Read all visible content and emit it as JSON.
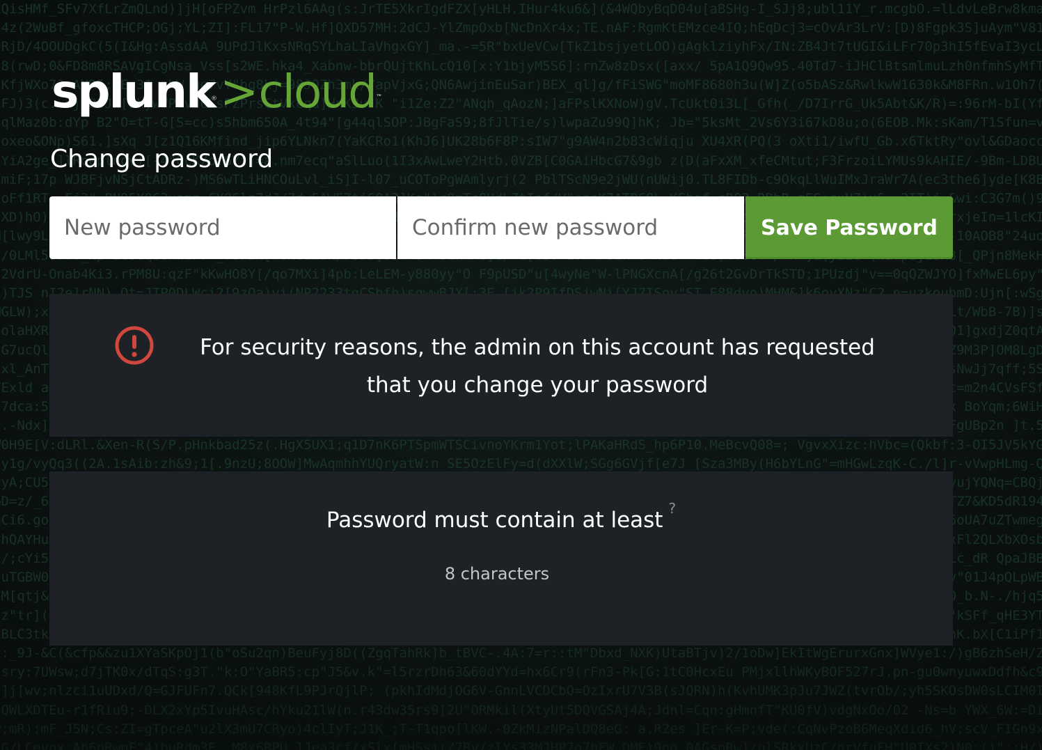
{
  "logo": {
    "brand": "splunk",
    "separator": ">",
    "product": "cloud",
    "registered_mark": "®",
    "trademark_mark": "™"
  },
  "page": {
    "title": "Change password"
  },
  "form": {
    "new_password_placeholder": "New password",
    "new_password_value": "",
    "confirm_password_placeholder": "Confirm new password",
    "confirm_password_value": "",
    "save_label": "Save Password"
  },
  "alert": {
    "icon": "exclamation-circle-icon",
    "message": "For security reasons, the admin on this account has requested that you change your password"
  },
  "requirements": {
    "title": "Password must contain at least",
    "help_mark": "?",
    "items": [
      "8 characters"
    ]
  },
  "colors": {
    "accent_green": "#65a637",
    "button_green": "#5b9a35",
    "panel_bg": "#1e2226",
    "alert_red": "#d0473d"
  }
}
